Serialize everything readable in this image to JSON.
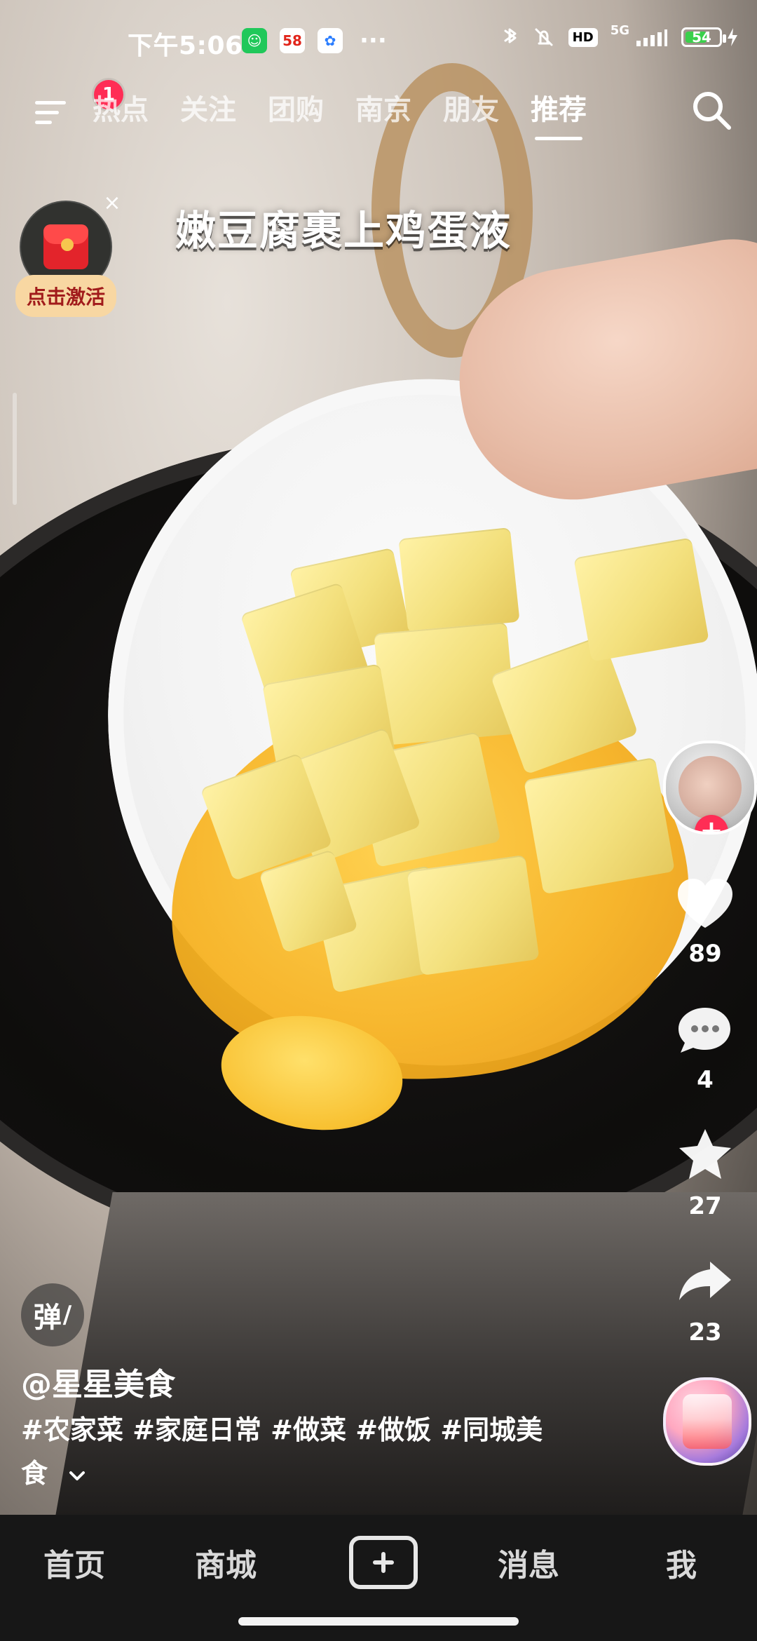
{
  "status_bar": {
    "time": "下午5:06",
    "app_icons": [
      "green-cat-icon",
      "58-icon",
      "colorful-app-icon"
    ],
    "more": "···",
    "network": "5G",
    "hd": "HD",
    "battery_percent": "54"
  },
  "top_nav": {
    "notification_count": "1",
    "tabs": [
      {
        "label": "热点"
      },
      {
        "label": "关注"
      },
      {
        "label": "团购"
      },
      {
        "label": "南京"
      },
      {
        "label": "朋友"
      },
      {
        "label": "推荐"
      }
    ],
    "active_tab_index": 5
  },
  "overlay": {
    "video_title": "嫩豆腐裹上鸡蛋液"
  },
  "promo": {
    "cta": "点击激活"
  },
  "right_rail": {
    "like_count": "89",
    "comment_count": "4",
    "favorite_count": "27",
    "share_count": "23"
  },
  "post": {
    "danmu_label": "弹",
    "author": "@星星美食",
    "hashtags_line1": "#农家菜 #家庭日常 #做菜 #做饭 #同城美",
    "hashtags_line2": "食"
  },
  "bottom_nav": {
    "items": [
      {
        "label": "首页"
      },
      {
        "label": "商城"
      },
      {
        "label": "消息"
      },
      {
        "label": "我"
      }
    ]
  },
  "colors": {
    "accent_pink": "#ff2d55",
    "battery_green": "#3ad04b",
    "promo_bg": "#f8d7a2"
  }
}
